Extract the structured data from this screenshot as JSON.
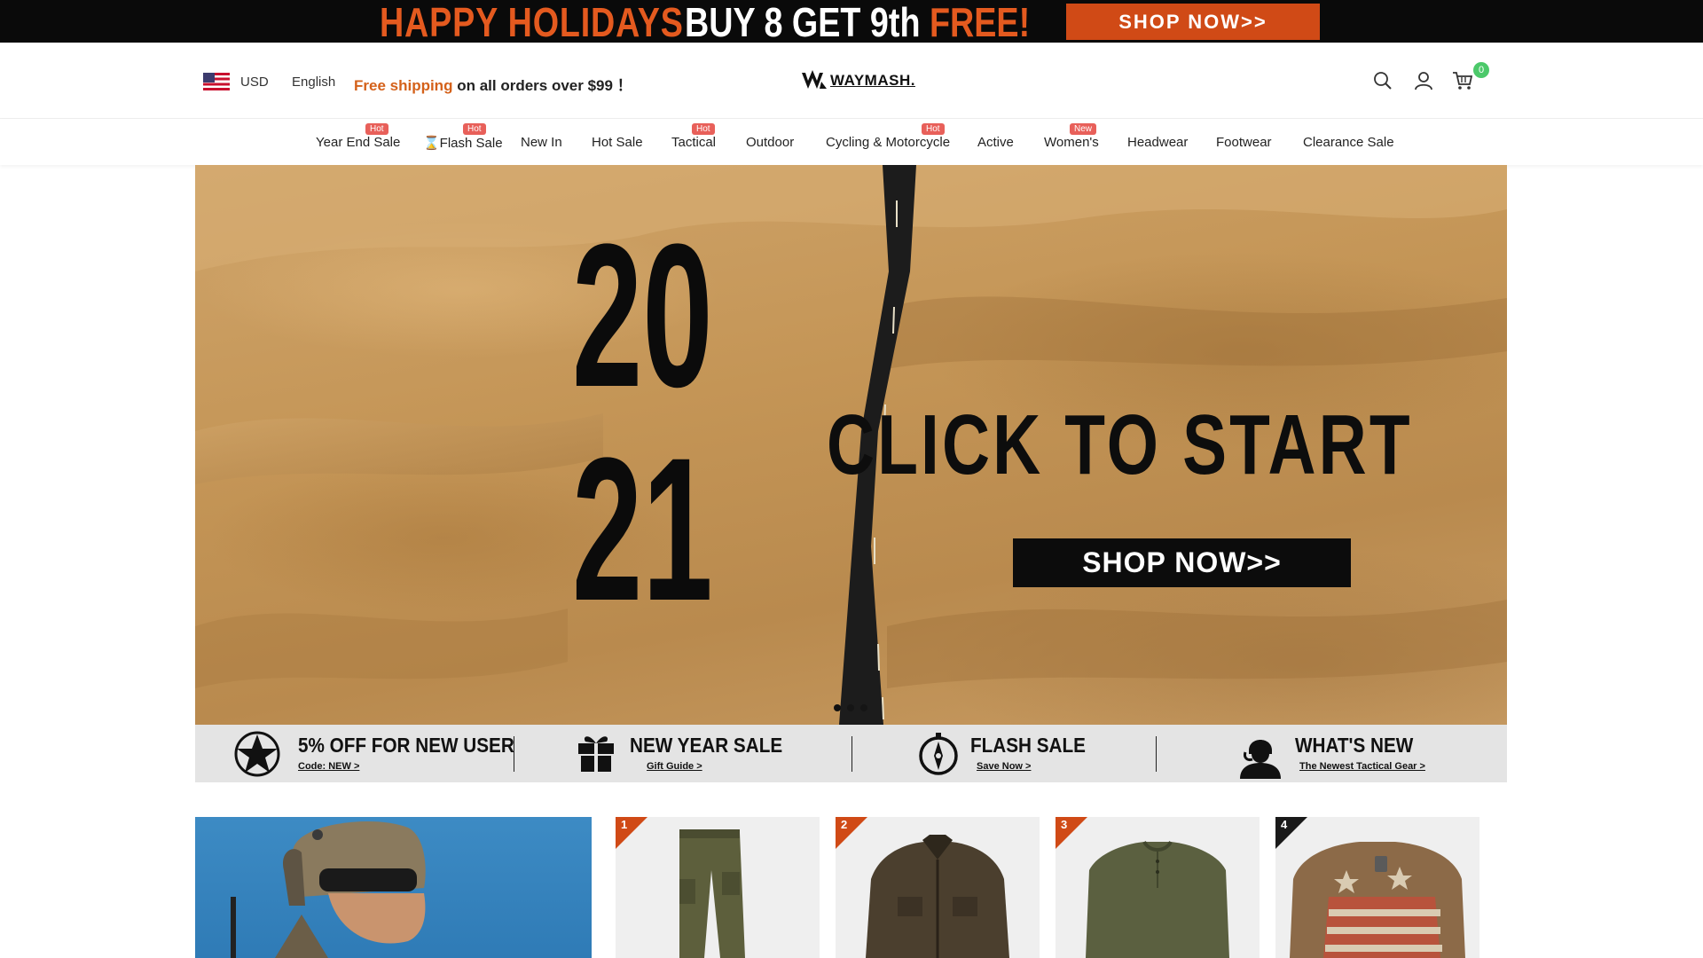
{
  "promo_bar": {
    "left_text": "HAPPY HOLIDAYS",
    "middle_text": "BUY 8 GET 9th",
    "middle_accent": "FREE!",
    "button_label": "SHOP NOW>>",
    "accent_color": "#e45a1f"
  },
  "header": {
    "currency": "USD",
    "language": "English",
    "shipping_highlight": "Free shipping",
    "shipping_rest": "on all orders over $99 ！",
    "logo_text": "WAYMASH.",
    "cart_count": "0"
  },
  "nav": {
    "items": [
      {
        "label": "Year End Sale",
        "tag": "Hot"
      },
      {
        "label": "⌛Flash Sale",
        "tag": "Hot"
      },
      {
        "label": "New In",
        "tag": ""
      },
      {
        "label": "Hot Sale",
        "tag": ""
      },
      {
        "label": "Tactical",
        "tag": "Hot"
      },
      {
        "label": "Outdoor",
        "tag": ""
      },
      {
        "label": "Cycling & Motorcycle",
        "tag": "Hot"
      },
      {
        "label": "Active",
        "tag": ""
      },
      {
        "label": "Women's",
        "tag": "New"
      },
      {
        "label": "Headwear",
        "tag": ""
      },
      {
        "label": "Footwear",
        "tag": ""
      },
      {
        "label": "Clearance Sale",
        "tag": ""
      }
    ]
  },
  "hero": {
    "year_top": "20",
    "year_bottom": "21",
    "headline": "CLICK TO START",
    "button_label": "SHOP NOW>>",
    "slide_count": 3,
    "active_slide": 1
  },
  "features": [
    {
      "title": "5% OFF FOR NEW USER",
      "subtitle": "Code:  NEW >",
      "icon": "star-icon"
    },
    {
      "title": "NEW YEAR SALE",
      "subtitle": "Gift Guide >",
      "icon": "gift-icon"
    },
    {
      "title": "FLASH SALE",
      "subtitle": "Save Now >",
      "icon": "compass-icon"
    },
    {
      "title": "WHAT'S NEW",
      "subtitle": "The Newest Tactical Gear >",
      "icon": "soldier-icon"
    }
  ],
  "products": {
    "ranks": [
      "1",
      "2",
      "3",
      "4"
    ],
    "rank_color": "#d04a16"
  }
}
